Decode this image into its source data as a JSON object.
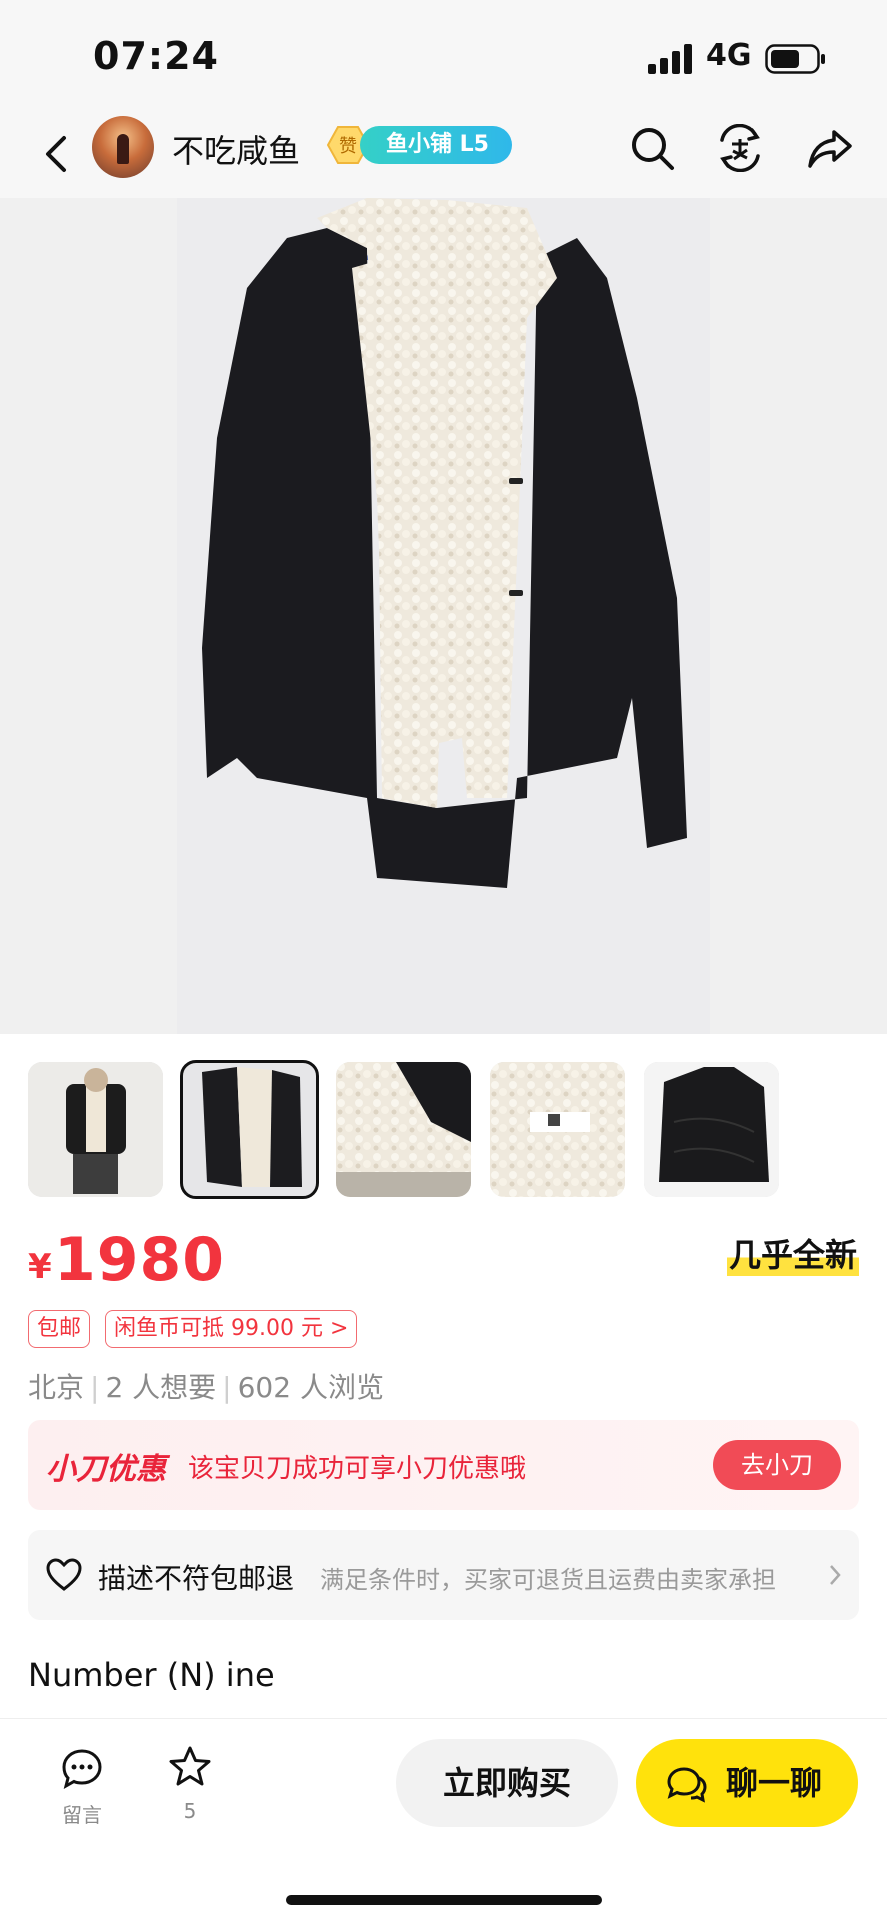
{
  "status_bar": {
    "time": "07:24",
    "network": "4G"
  },
  "header": {
    "seller_name": "不吃咸鱼",
    "badge_zan": "赞",
    "shop_badge": "鱼小铺 L5"
  },
  "product": {
    "currency": "¥",
    "price": "1980",
    "condition": "几乎全新",
    "tags": [
      "包邮",
      "闲鱼币可抵 99.00 元 >"
    ],
    "location": "北京",
    "wants": "2 人想要",
    "views": "602 人浏览",
    "description": "Number (N) ine"
  },
  "promo": {
    "title": "小刀优惠",
    "desc": "该宝贝刀成功可享小刀优惠哦",
    "button": "去小刀"
  },
  "guarantee": {
    "title": "描述不符包邮退",
    "desc": "满足条件时，买家可退货且运费由卖家承担"
  },
  "bottom_bar": {
    "comment_label": "留言",
    "fav_count": "5",
    "buy_label": "立即购买",
    "chat_label": "聊一聊"
  },
  "colors": {
    "price": "#f2343e",
    "chat_button": "#ffe20c",
    "shop_badge": "#2fb8ea"
  }
}
